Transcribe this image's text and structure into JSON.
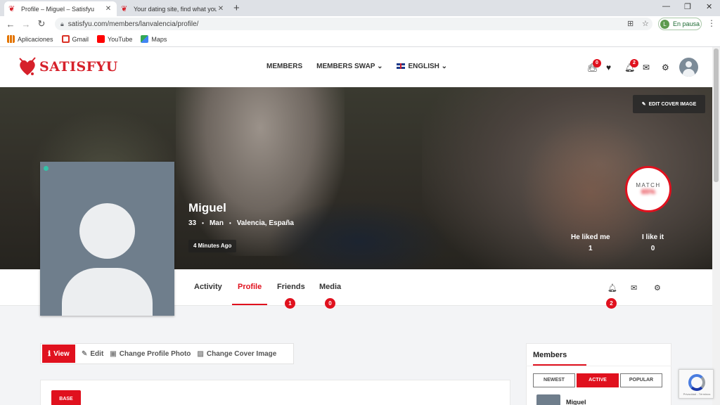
{
  "browser": {
    "tabs": [
      {
        "title": "Profile – Miguel – Satisfyu",
        "active": true
      },
      {
        "title": "Your dating site, find what you are",
        "active": false
      }
    ],
    "url": "satisfyu.com/members/lanvalencia/profile/",
    "profile_chip": {
      "initial": "L",
      "label": "En pausa"
    },
    "bookmarks": [
      {
        "label": "Aplicaciones",
        "icon": "apps-grid-icon",
        "color": "#e37400"
      },
      {
        "label": "Gmail",
        "icon": "gmail-icon",
        "color": "#d93025"
      },
      {
        "label": "YouTube",
        "icon": "youtube-icon",
        "color": "#ff0000"
      },
      {
        "label": "Maps",
        "icon": "maps-icon",
        "color": "#34a853"
      }
    ]
  },
  "site": {
    "brand": "SATISFYU",
    "brand_color": "#d6202a",
    "nav": [
      {
        "label": "MEMBERS"
      },
      {
        "label": "MEMBERS SWAP ⌄"
      },
      {
        "label": "ENGLISH ⌄"
      }
    ],
    "header_icons": [
      {
        "icon": "basket-icon",
        "badge": "0"
      },
      {
        "icon": "heart-icon",
        "badge": ""
      },
      {
        "icon": "notifications-icon",
        "badge": "2"
      },
      {
        "icon": "envelope-icon",
        "badge": ""
      },
      {
        "icon": "gear-icon",
        "badge": ""
      }
    ]
  },
  "profile": {
    "edit_cover_label": "EDIT COVER IMAGE",
    "name": "Miguel",
    "age": "33",
    "gender": "Man",
    "location": "Valencia, España",
    "last_active": "4 Minutes Ago",
    "match_label": "MATCH",
    "match_value": "65%",
    "he_liked_me_label": "He liked me",
    "he_liked_me_value": "1",
    "i_like_it_label": "I like it",
    "i_like_it_value": "0",
    "tabs": [
      {
        "label": "Activity",
        "badge": ""
      },
      {
        "label": "Profile",
        "badge": "",
        "active": true
      },
      {
        "label": "Friends",
        "badge": "1"
      },
      {
        "label": "Media",
        "badge": "0"
      }
    ],
    "actions_badge": "2"
  },
  "content": {
    "actions": [
      {
        "label": "View",
        "active": true
      },
      {
        "label": "Edit"
      },
      {
        "label": "Change Profile Photo"
      },
      {
        "label": "Change Cover Image"
      }
    ],
    "base_label": "BASE"
  },
  "sidebar": {
    "members_title": "Members",
    "filters": [
      "NEWEST",
      "ACTIVE",
      "POPULAR"
    ],
    "active_filter": "ACTIVE",
    "first_member": "Miguel"
  },
  "recaptcha_text": "Privacidad - Términos"
}
